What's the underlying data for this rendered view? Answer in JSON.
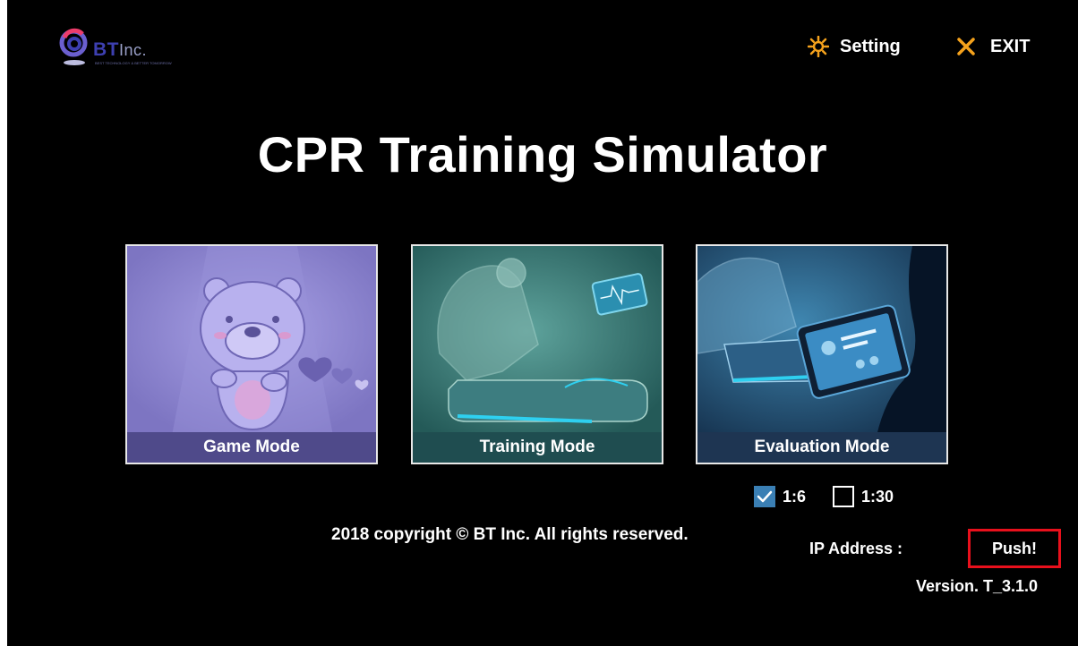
{
  "header": {
    "logo": {
      "brand": "BT",
      "suffix": "Inc.",
      "tagline": "BEST TECHNOLOGY & BETTER TOMORROW"
    },
    "setting_label": "Setting",
    "exit_label": "EXIT"
  },
  "title": "CPR Training Simulator",
  "modes": [
    {
      "label": "Game Mode"
    },
    {
      "label": "Training Mode"
    },
    {
      "label": "Evaluation Mode"
    }
  ],
  "ratio_options": [
    {
      "label": "1:6",
      "checked": true
    },
    {
      "label": "1:30",
      "checked": false
    }
  ],
  "footer": {
    "copyright": "2018 copyright © BT Inc. All rights reserved.",
    "ip_label": "IP Address :",
    "push_label": "Push!",
    "version": "Version. T_3.1.0"
  },
  "colors": {
    "background": "#000000",
    "accent_orange": "#f5a21c",
    "push_border": "#e8101c",
    "checkbox_fill": "#3a7fb4",
    "brand_blue": "#3d3fb0"
  },
  "icons": {
    "logo": "bt-logo-icon",
    "setting": "gear-sun-icon",
    "exit": "close-x-icon",
    "checkbox_checked": "checkmark-icon"
  }
}
